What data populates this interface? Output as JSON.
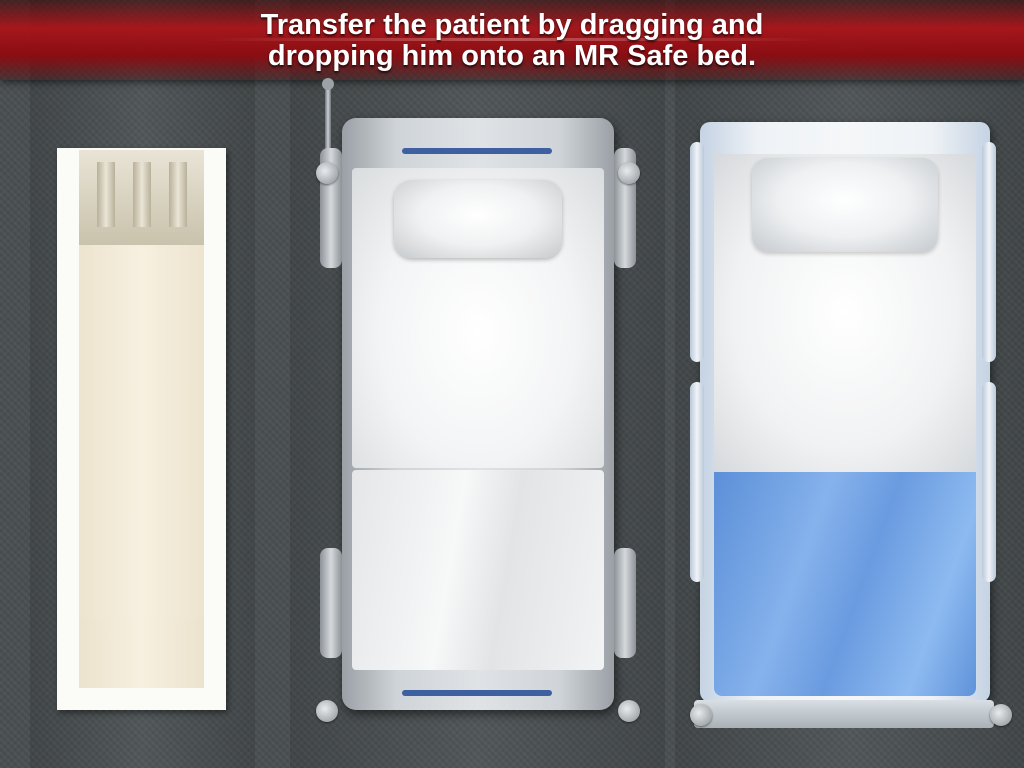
{
  "instruction": {
    "line1": "Transfer the patient by dragging and",
    "line2": "dropping him onto an MR Safe bed."
  },
  "colors": {
    "banner_red": "#aa1419",
    "floor": "#4a5052",
    "blanket_blue": "#6a9be0",
    "rail_stripe_blue": "#3e5fa0"
  },
  "objects": {
    "stretcher": "transport-stretcher",
    "standard_bed": "hospital-bed",
    "mr_safe_bed": "mr-safe-bed"
  }
}
